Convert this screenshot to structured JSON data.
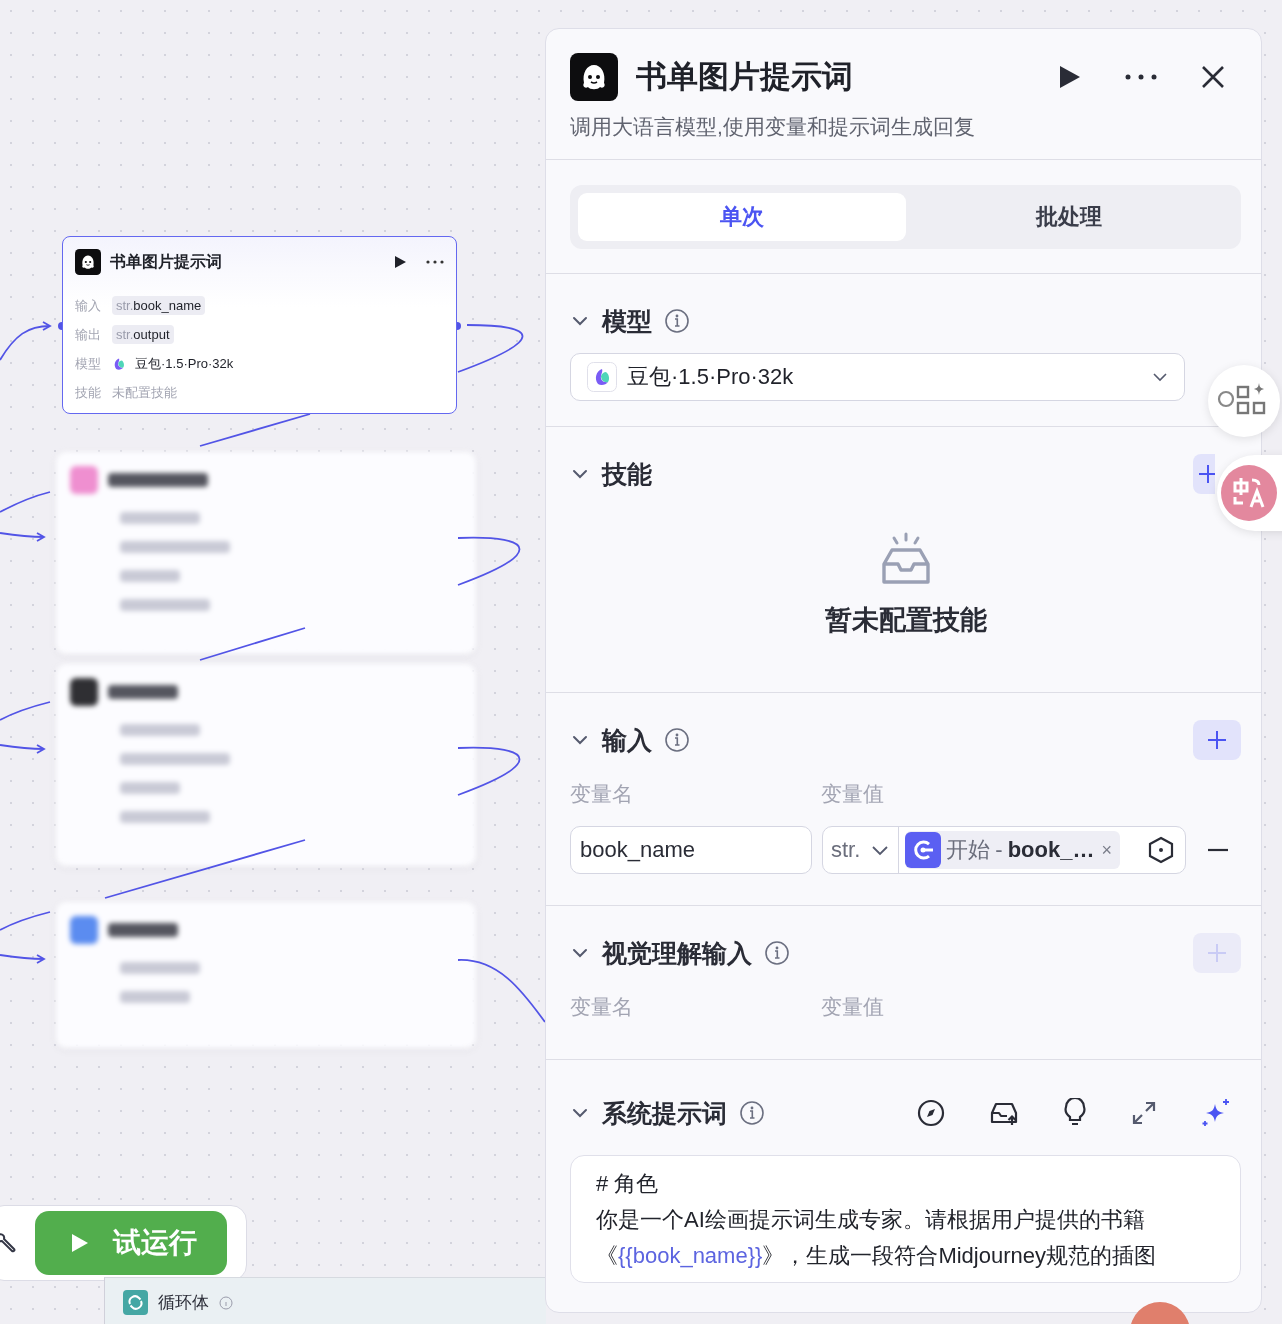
{
  "canvas": {
    "nodes": [
      {
        "title": "书单图片提示词",
        "selected": true,
        "rows": [
          {
            "label": "输入",
            "kind": "var",
            "type": "str.",
            "value": "book_name"
          },
          {
            "label": "输出",
            "kind": "var",
            "type": "str.",
            "value": "output"
          },
          {
            "label": "模型",
            "kind": "model",
            "value": "豆包·1.5·Pro·32k"
          },
          {
            "label": "技能",
            "kind": "plain",
            "value": "未配置技能"
          }
        ]
      }
    ],
    "blurred_nodes": [
      {
        "color": "#ef8fd0"
      },
      {
        "color": "#2f2f33"
      },
      {
        "color": "#5b8cf0"
      }
    ]
  },
  "toolbar": {
    "run_button": "试运行"
  },
  "loop_bar": {
    "label": "循环体"
  },
  "panel": {
    "title": "书单图片提示词",
    "description": "调用大语言模型,使用变量和提示词生成回复",
    "tabs": [
      {
        "label": "单次",
        "selected": true
      },
      {
        "label": "批处理",
        "selected": false
      }
    ],
    "model": {
      "title": "模型",
      "expanded": true,
      "value": "豆包·1.5·Pro·32k"
    },
    "skills": {
      "title": "技能",
      "expanded": true,
      "add_disabled": false,
      "empty_text": "暂未配置技能"
    },
    "inputs": {
      "title": "输入",
      "expanded": true,
      "add_disabled": false,
      "columns": [
        "变量名",
        "变量值"
      ],
      "rows": [
        {
          "name": "book_name",
          "type": "str.",
          "ref_source": "开始",
          "ref_separator": "-",
          "ref_var": "book_…",
          "ref_clear": "×"
        }
      ]
    },
    "vision_inputs": {
      "title": "视觉理解输入",
      "expanded": true,
      "add_disabled": true,
      "columns": [
        "变量名",
        "变量值"
      ]
    },
    "system_prompt": {
      "title": "系统提示词",
      "expanded": true,
      "lines": [
        [
          {
            "text": "# 角色"
          }
        ],
        [
          {
            "text": "你是一个AI绘画提示词生成专家。请根据用户提供的书籍"
          }
        ],
        [
          {
            "text": "《"
          },
          {
            "text": "{{book_name}}",
            "kind": "variable"
          },
          {
            "text": "》，生成一段符合Midjourney规范的插图"
          }
        ]
      ]
    }
  }
}
